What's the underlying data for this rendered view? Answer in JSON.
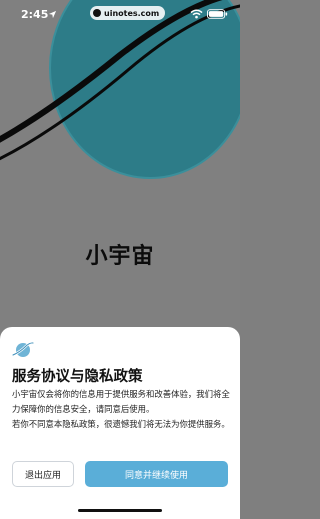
{
  "status_bar": {
    "time": "2:45",
    "watermark": "uinotes.com"
  },
  "splash": {
    "app_title": "小宇宙"
  },
  "privacy_sheet": {
    "title": "服务协议与隐私政策",
    "paragraph_1": "小宇宙仅会将你的信息用于提供服务和改善体验，我们将全力保障你的信息安全，请同意后使用。",
    "paragraph_2": "若你不同意本隐私政策，很遗憾我们将无法为你提供服务。",
    "exit_button": "退出应用",
    "agree_button": "同意并继续使用"
  },
  "colors": {
    "overlay_bg": "#808080",
    "planet": "#2e7f8c",
    "agree_button": "#5aaed8"
  }
}
